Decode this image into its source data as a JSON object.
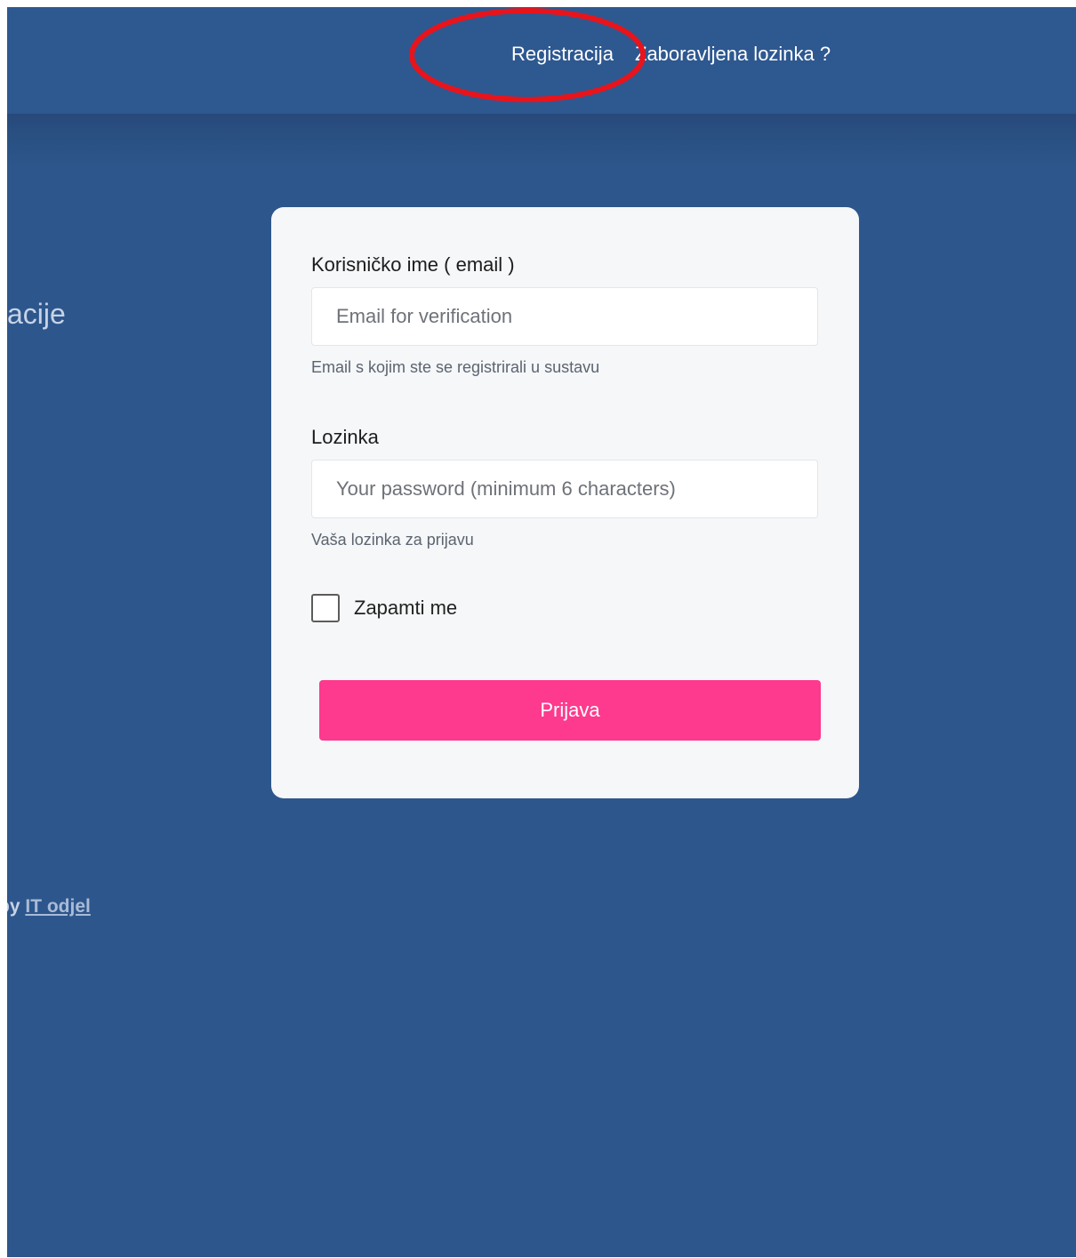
{
  "header": {
    "register_link": "Registracija",
    "forgot_password_link": "Zaboravljena lozinka ?"
  },
  "side": {
    "partial_heading": "acije"
  },
  "login_form": {
    "email_label": "Korisničko ime ( email )",
    "email_placeholder": "Email for verification",
    "email_hint": "Email s kojim ste se registrirali u sustavu",
    "password_label": "Lozinka",
    "password_placeholder": "Your password (minimum 6 characters)",
    "password_hint": "Vaša lozinka za prijavu",
    "remember_label": "Zapamti me",
    "submit_label": "Prijava"
  },
  "footer": {
    "credit_prefix": "by",
    "credit_link": "IT odjel"
  },
  "colors": {
    "page_background": "#2d568c",
    "card_background": "#f5f7f9",
    "submit_button": "#fd3a8d",
    "annotation_ellipse": "#e8141c"
  }
}
